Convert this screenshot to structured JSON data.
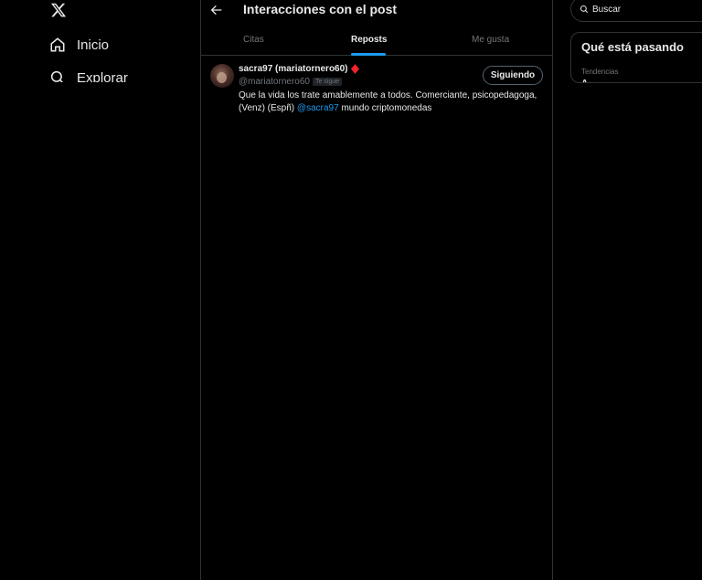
{
  "nav": {
    "logo": "x-logo-icon",
    "items": [
      {
        "label": "Inicio",
        "icon": "home-icon"
      },
      {
        "label": "Explorar",
        "icon": "search-icon"
      }
    ]
  },
  "header": {
    "title": "Interacciones con el post"
  },
  "tabs": [
    {
      "label": "Citas",
      "active": false
    },
    {
      "label": "Reposts",
      "active": true
    },
    {
      "label": "Me gusta",
      "active": false
    }
  ],
  "user": {
    "display_name": "sacra97 (mariatornero60)",
    "handle": "@mariatornero60",
    "follows_you": "Te sigue",
    "follow_button": "Siguiendo",
    "bio_text": "Que la vida los trate amablemente a todos. Comerciante, psicopedagoga, (Venz) (Espñ)",
    "bio_mention": "@sacra97",
    "bio_tail": "mundo criptomonedas"
  },
  "search": {
    "placeholder": "Buscar"
  },
  "trends": {
    "title": "Qué está pasando",
    "subtitle": "Tendencias",
    "peek": "A"
  },
  "colors": {
    "background": "#000000",
    "accent": "#1d9bf0",
    "text": "#e7e9ea",
    "muted": "#71767b",
    "border": "#2f3336",
    "diamond": "#f4212e"
  }
}
